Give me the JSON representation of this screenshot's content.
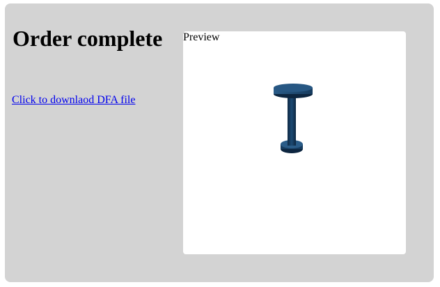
{
  "page": {
    "title": "Order complete",
    "download_link": "Click to downlaod DFA file"
  },
  "preview": {
    "label": "Preview",
    "model_color": "#1f4f7a"
  }
}
